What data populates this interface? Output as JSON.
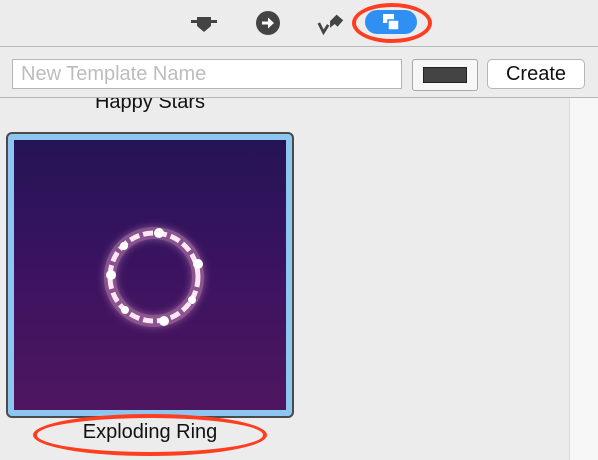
{
  "toolbar": {
    "tabs": [
      {
        "icon": "shield-icon",
        "selected": false
      },
      {
        "icon": "arrow-right-circle-icon",
        "selected": false
      },
      {
        "icon": "checkmark-pin-icon",
        "selected": false
      },
      {
        "icon": "layers-icon",
        "selected": true
      }
    ],
    "highlight_color": "#ff3d1f",
    "selected_color": "#2f8ff2"
  },
  "create_row": {
    "name_placeholder": "New Template Name",
    "name_value": "",
    "color_well_value": "#444444",
    "create_label": "Create"
  },
  "templates": [
    {
      "name": "Happy Stars",
      "selected": false
    },
    {
      "name": "Exploding Ring",
      "selected": true,
      "thumbnail": "ring-glow-icon"
    }
  ]
}
